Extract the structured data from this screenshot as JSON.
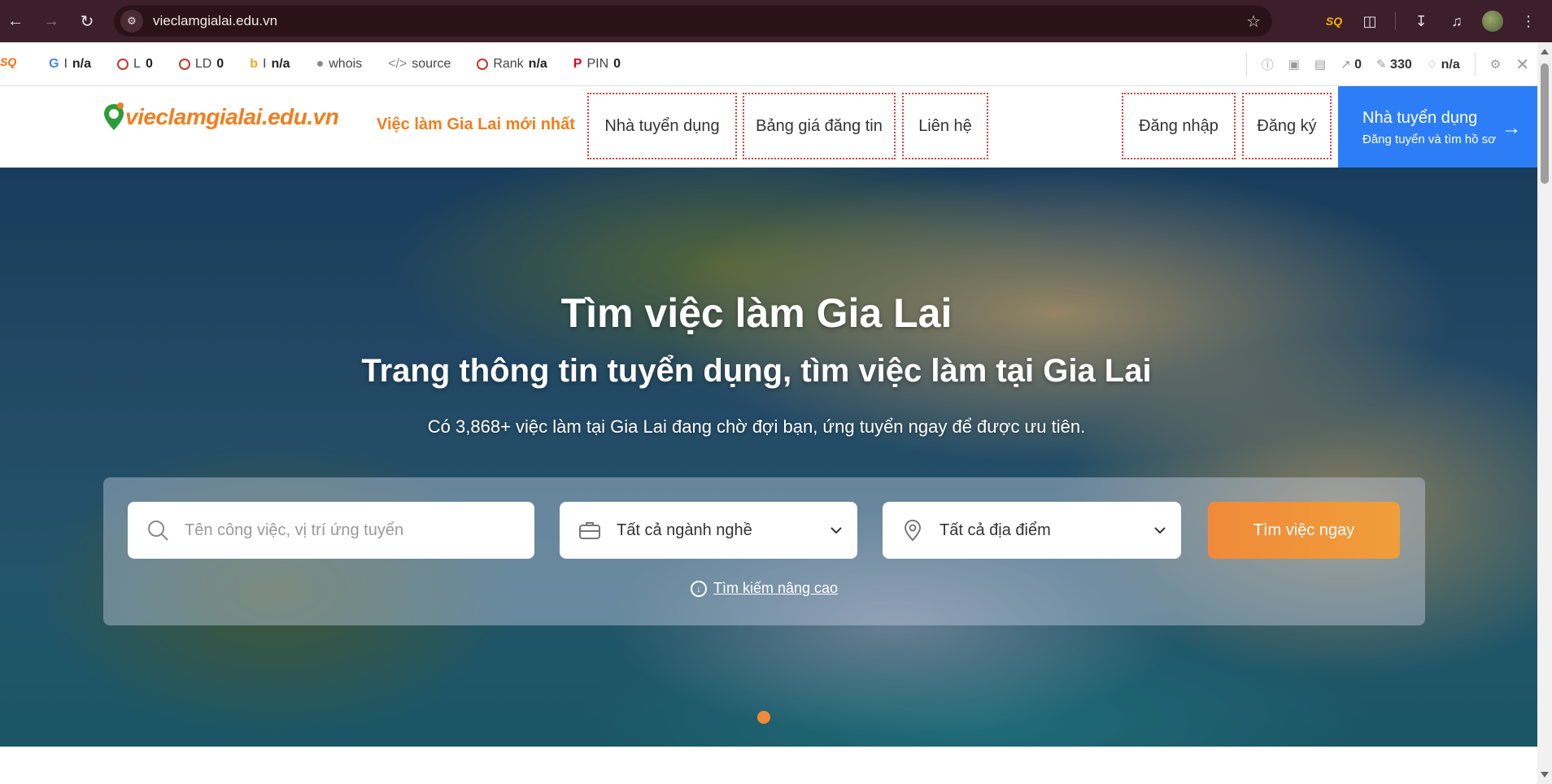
{
  "browser": {
    "url": "vieclamgialai.edu.vn",
    "back_icon": "arrow-left-icon",
    "forward_icon": "arrow-right-icon",
    "reload_icon": "reload-icon"
  },
  "seo_toolbar": {
    "google": {
      "label": "I",
      "value": "n/a"
    },
    "links": {
      "label": "L",
      "value": "0"
    },
    "linking_domains": {
      "label": "LD",
      "value": "0"
    },
    "bing": {
      "label": "I",
      "value": "n/a"
    },
    "whois": "whois",
    "source": "source",
    "rank": {
      "label": "Rank",
      "value": "n/a"
    },
    "pin": {
      "label": "PIN",
      "value": "0"
    },
    "right": {
      "external": "0",
      "pages": "330",
      "score": "n/a"
    }
  },
  "site": {
    "logo_text": "vieclamgialai.edu.vn",
    "nav": {
      "jobs_latest": "Việc làm Gia Lai mới nhất",
      "employers": "Nhà tuyển dụng",
      "pricing": "Bảng giá đăng tin",
      "contact": "Liên hệ",
      "login": "Đăng nhập",
      "register": "Đăng ký"
    },
    "cta": {
      "title": "Nhà tuyển dụng",
      "subtitle": "Đăng tuyển và tìm hồ sơ"
    }
  },
  "hero": {
    "title": "Tìm việc làm Gia Lai",
    "subtitle": "Trang thông tin tuyển dụng, tìm việc làm tại Gia Lai",
    "count_text": "Có 3,868+ việc làm tại Gia Lai đang chờ đợi bạn, ứng tuyển ngay để được ưu tiên.",
    "search": {
      "keyword_placeholder": "Tên công việc, vị trí ứng tuyển",
      "industry_value": "Tất cả ngành nghề",
      "location_value": "Tất cả địa điểm",
      "button": "Tìm việc ngay",
      "advanced": "Tìm kiếm nâng cao"
    }
  },
  "colors": {
    "brand_orange": "#f07e1f",
    "cta_blue": "#2d7df7",
    "chrome_bg": "#3c1f2a"
  }
}
